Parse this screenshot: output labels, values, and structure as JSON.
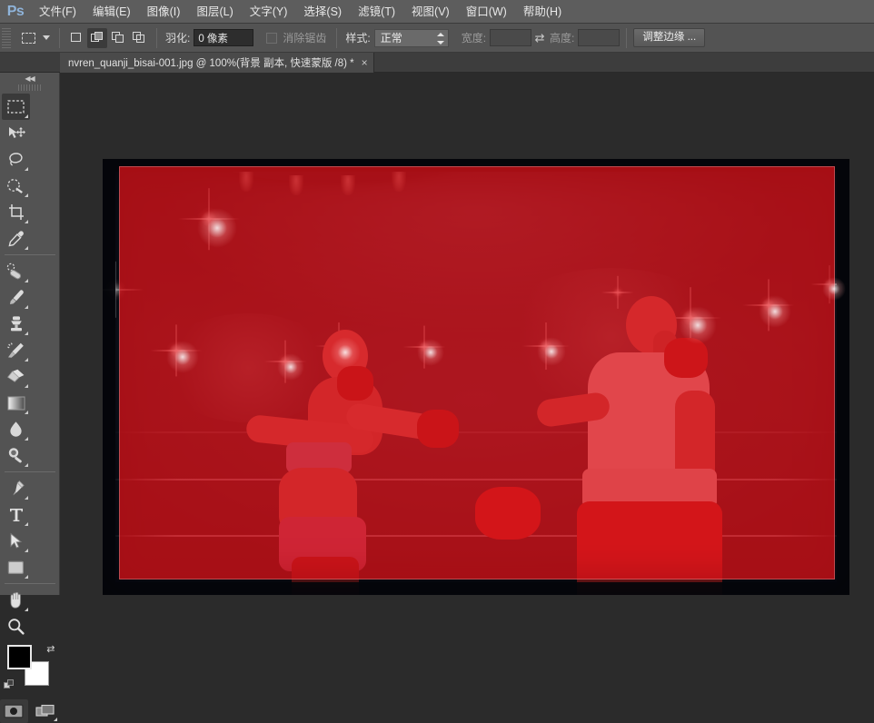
{
  "app": {
    "name": "Ps",
    "logo_text": "Ps"
  },
  "menubar": {
    "items": [
      {
        "label": "文件(F)",
        "name": "menu-file"
      },
      {
        "label": "编辑(E)",
        "name": "menu-edit"
      },
      {
        "label": "图像(I)",
        "name": "menu-image"
      },
      {
        "label": "图层(L)",
        "name": "menu-layer"
      },
      {
        "label": "文字(Y)",
        "name": "menu-type"
      },
      {
        "label": "选择(S)",
        "name": "menu-select"
      },
      {
        "label": "滤镜(T)",
        "name": "menu-filter"
      },
      {
        "label": "视图(V)",
        "name": "menu-view"
      },
      {
        "label": "窗口(W)",
        "name": "menu-window"
      },
      {
        "label": "帮助(H)",
        "name": "menu-help"
      }
    ]
  },
  "options_bar": {
    "active_tool_icon": "rectangular-marquee-icon",
    "selection_modes": [
      {
        "name": "new-selection",
        "active": false
      },
      {
        "name": "add-to-selection",
        "active": true
      },
      {
        "name": "subtract-from-selection",
        "active": false
      },
      {
        "name": "intersect-selection",
        "active": false
      }
    ],
    "feather_label": "羽化:",
    "feather_value": "0 像素",
    "antialias_label": "消除锯齿",
    "antialias_checked": false,
    "style_label": "样式:",
    "style_value": "正常",
    "width_label": "宽度:",
    "width_value": "",
    "height_label": "高度:",
    "height_value": "",
    "swap_icon": "swap-dimensions-icon",
    "refine_edge_label": "调整边缘 ..."
  },
  "tab_bar": {
    "document_title": "nvren_quanji_bisai-001.jpg @ 100%(背景 副本, 快速蒙版 /8) *",
    "close_glyph": "×"
  },
  "tool_panel": {
    "collapse_glyph": "◀◀",
    "tools": [
      {
        "name": "rectangular-marquee-tool",
        "active": true,
        "has_submenu": true
      },
      {
        "name": "move-tool",
        "active": false,
        "has_submenu": false
      },
      {
        "name": "lasso-tool",
        "active": false,
        "has_submenu": true
      },
      {
        "name": "quick-selection-tool",
        "active": false,
        "has_submenu": true
      },
      {
        "name": "crop-tool",
        "active": false,
        "has_submenu": true
      },
      {
        "name": "eyedropper-tool",
        "active": false,
        "has_submenu": true
      },
      {
        "name": "spot-healing-brush-tool",
        "active": false,
        "has_submenu": true
      },
      {
        "name": "brush-tool",
        "active": false,
        "has_submenu": true
      },
      {
        "name": "clone-stamp-tool",
        "active": false,
        "has_submenu": true
      },
      {
        "name": "history-brush-tool",
        "active": false,
        "has_submenu": true
      },
      {
        "name": "eraser-tool",
        "active": false,
        "has_submenu": true
      },
      {
        "name": "gradient-tool",
        "active": false,
        "has_submenu": true
      },
      {
        "name": "blur-tool",
        "active": false,
        "has_submenu": true
      },
      {
        "name": "dodge-tool",
        "active": false,
        "has_submenu": true
      },
      {
        "name": "pen-tool",
        "active": false,
        "has_submenu": true
      },
      {
        "name": "horizontal-type-tool",
        "active": false,
        "has_submenu": true
      },
      {
        "name": "path-selection-tool",
        "active": false,
        "has_submenu": true
      },
      {
        "name": "rectangle-tool",
        "active": false,
        "has_submenu": true
      },
      {
        "name": "hand-tool",
        "active": false,
        "has_submenu": true
      },
      {
        "name": "zoom-tool",
        "active": false,
        "has_submenu": false
      }
    ],
    "foreground_color": "#000000",
    "background_color": "#ffffff",
    "swap_colors_icon": "swap-colors-icon",
    "reset_colors_icon": "reset-colors-icon",
    "quick_mask_active": true,
    "quick_mask_name": "quick-mask-mode-button",
    "screen_mode_name": "screen-mode-button"
  },
  "canvas": {
    "zoom_level": "100%",
    "quick_mask_overlay_color": "#de1218",
    "quick_mask_opacity": "74%",
    "image_subject": "two female boxers in a ring under arena spotlights"
  }
}
